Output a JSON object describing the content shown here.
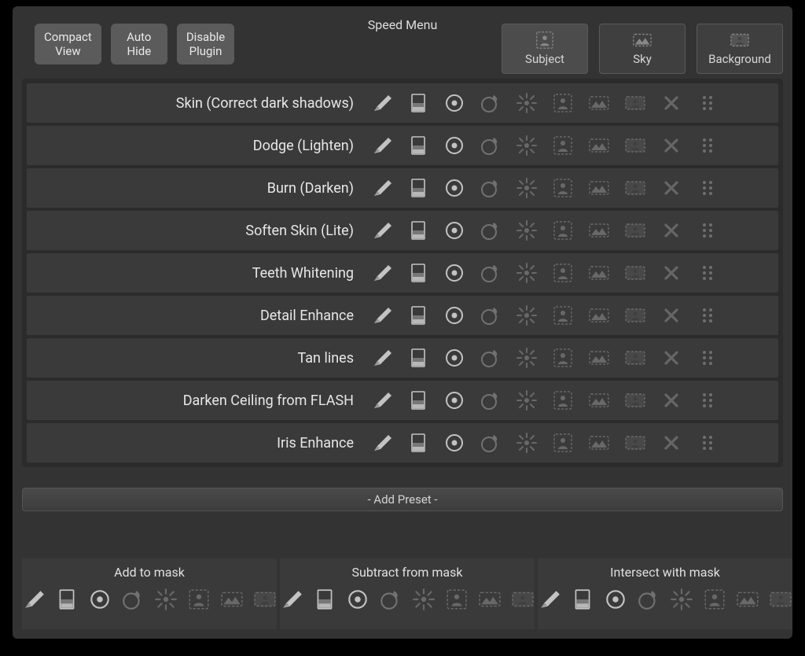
{
  "header": {
    "title": "Speed Menu",
    "buttons": {
      "compact_view_l1": "Compact",
      "compact_view_l2": "View",
      "auto_hide_l1": "Auto",
      "auto_hide_l2": "Hide",
      "disable_plugin_l1": "Disable",
      "disable_plugin_l2": "Plugin"
    },
    "tabs": {
      "subject": "Subject",
      "sky": "Sky",
      "background": "Background"
    }
  },
  "presets": [
    "Skin (Correct dark shadows)",
    "Dodge (Lighten)",
    "Burn (Darken)",
    "Soften Skin (Lite)",
    "Teeth Whitening",
    "Detail Enhance",
    "Tan lines",
    "Darken Ceiling from FLASH",
    "Iris Enhance"
  ],
  "icons": {
    "brush": "brush",
    "gradient": "gradient",
    "radial": "radial",
    "color": "color-range",
    "luminance": "luminance-range",
    "subject": "subject-mask",
    "sky": "sky-mask",
    "background": "background-mask",
    "delete": "delete",
    "drag": "drag-handle"
  },
  "add_preset_label": "- Add Preset -",
  "mask_panels": [
    {
      "title": "Add to mask"
    },
    {
      "title": "Subtract from mask"
    },
    {
      "title": "Intersect with mask"
    }
  ]
}
